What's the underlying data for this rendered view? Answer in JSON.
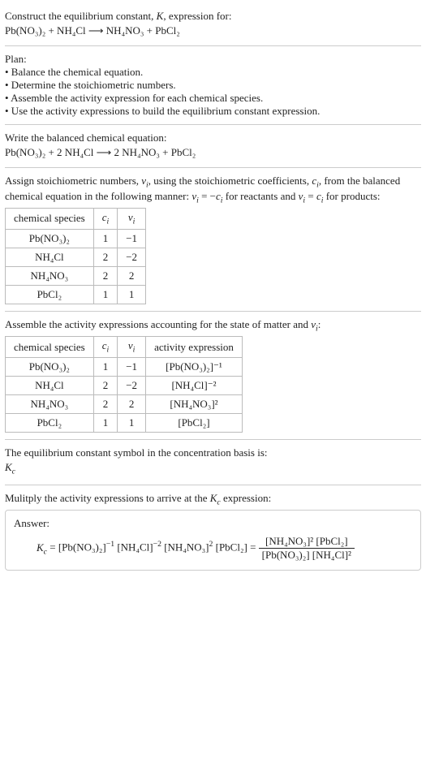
{
  "intro": {
    "line1": "Construct the equilibrium constant, K, expression for:",
    "equation": "Pb(NO₃)₂ + NH₄Cl ⟶ NH₄NO₃ + PbCl₂"
  },
  "plan": {
    "heading": "Plan:",
    "b1": "• Balance the chemical equation.",
    "b2": "• Determine the stoichiometric numbers.",
    "b3": "• Assemble the activity expression for each chemical species.",
    "b4": "• Use the activity expressions to build the equilibrium constant expression."
  },
  "balanced": {
    "heading": "Write the balanced chemical equation:",
    "equation": "Pb(NO₃)₂ + 2 NH₄Cl ⟶ 2 NH₄NO₃ + PbCl₂"
  },
  "stoich": {
    "text": "Assign stoichiometric numbers, νᵢ, using the stoichiometric coefficients, cᵢ, from the balanced chemical equation in the following manner: νᵢ = −cᵢ for reactants and νᵢ = cᵢ for products:",
    "headers": {
      "h1": "chemical species",
      "h2": "cᵢ",
      "h3": "νᵢ"
    },
    "rows": [
      {
        "sp": "Pb(NO₃)₂",
        "c": "1",
        "v": "−1"
      },
      {
        "sp": "NH₄Cl",
        "c": "2",
        "v": "−2"
      },
      {
        "sp": "NH₄NO₃",
        "c": "2",
        "v": "2"
      },
      {
        "sp": "PbCl₂",
        "c": "1",
        "v": "1"
      }
    ]
  },
  "activity": {
    "text": "Assemble the activity expressions accounting for the state of matter and νᵢ:",
    "headers": {
      "h1": "chemical species",
      "h2": "cᵢ",
      "h3": "νᵢ",
      "h4": "activity expression"
    },
    "rows": [
      {
        "sp": "Pb(NO₃)₂",
        "c": "1",
        "v": "−1",
        "a": "[Pb(NO₃)₂]⁻¹"
      },
      {
        "sp": "NH₄Cl",
        "c": "2",
        "v": "−2",
        "a": "[NH₄Cl]⁻²"
      },
      {
        "sp": "NH₄NO₃",
        "c": "2",
        "v": "2",
        "a": "[NH₄NO₃]²"
      },
      {
        "sp": "PbCl₂",
        "c": "1",
        "v": "1",
        "a": "[PbCl₂]"
      }
    ]
  },
  "kconc": {
    "text": "The equilibrium constant symbol in the concentration basis is:",
    "symbol": "K_c"
  },
  "mult": {
    "text": "Mulitply the activity expressions to arrive at the K_c expression:"
  },
  "answer": {
    "label": "Answer:",
    "lhs": "K_c = [Pb(NO₃)₂]⁻¹ [NH₄Cl]⁻² [NH₄NO₃]² [PbCl₂] = ",
    "num": "[NH₄NO₃]² [PbCl₂]",
    "den": "[Pb(NO₃)₂] [NH₄Cl]²"
  },
  "chart_data": {
    "type": "table",
    "tables": [
      {
        "title": "Stoichiometric numbers",
        "columns": [
          "chemical species",
          "cᵢ",
          "νᵢ"
        ],
        "rows": [
          [
            "Pb(NO₃)₂",
            1,
            -1
          ],
          [
            "NH₄Cl",
            2,
            -2
          ],
          [
            "NH₄NO₃",
            2,
            2
          ],
          [
            "PbCl₂",
            1,
            1
          ]
        ]
      },
      {
        "title": "Activity expressions",
        "columns": [
          "chemical species",
          "cᵢ",
          "νᵢ",
          "activity expression"
        ],
        "rows": [
          [
            "Pb(NO₃)₂",
            1,
            -1,
            "[Pb(NO₃)₂]^-1"
          ],
          [
            "NH₄Cl",
            2,
            -2,
            "[NH₄Cl]^-2"
          ],
          [
            "NH₄NO₃",
            2,
            2,
            "[NH₄NO₃]^2"
          ],
          [
            "PbCl₂",
            1,
            1,
            "[PbCl₂]"
          ]
        ]
      }
    ]
  }
}
